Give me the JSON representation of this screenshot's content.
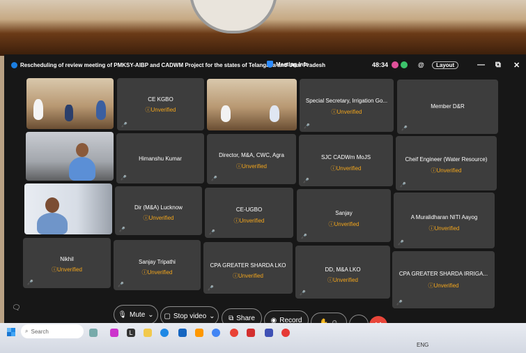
{
  "window": {
    "title": "Rescheduling of review meeting of PMKSY-AIBP and CADWM Project for the states of Telangana and Uttar Pradesh",
    "meeting_info": "Meeting Info",
    "timer": "48:34",
    "layout": "Layout",
    "minimize": "—",
    "restore": "⧉",
    "close": "✕"
  },
  "unverified_label": "Unverified",
  "tiles": [
    {
      "name": "",
      "video": true
    },
    {
      "name": "CE KGBO",
      "unverified": true
    },
    {
      "name": "",
      "video": true
    },
    {
      "name": "Special Secretary, Irrigation Go...",
      "unverified": true
    },
    {
      "name": "Member D&R"
    },
    {
      "name": "",
      "video": true
    },
    {
      "name": "Himanshu Kumar"
    },
    {
      "name": "Director, M&A, CWC, Agra",
      "unverified": true
    },
    {
      "name": "SJC CADWm MoJS",
      "unverified": true
    },
    {
      "name": "Cheif Engineer (Water Resource)",
      "unverified": true
    },
    {
      "name": "",
      "video": true
    },
    {
      "name": "Dir (M&A) Lucknow",
      "unverified": true
    },
    {
      "name": "CE-UGBO",
      "unverified": true
    },
    {
      "name": "Sanjay",
      "unverified": true
    },
    {
      "name": "A Muralidharan NITI Aayog",
      "unverified": true
    },
    {
      "name": "Nikhil",
      "unverified": true
    },
    {
      "name": "Sanjay Tripathi",
      "unverified": true
    },
    {
      "name": "CPA GREATER SHARDA LKO",
      "unverified": true
    },
    {
      "name": "DD, M&A LKO",
      "unverified": true
    },
    {
      "name": "CPA GREATER SHARDA IRRIGA...",
      "unverified": true
    }
  ],
  "toolbar": {
    "mute": "Mute",
    "stop_video": "Stop video",
    "share": "Share",
    "record": "Record",
    "more": "···",
    "leave": "✕"
  },
  "taskbar": {
    "search_placeholder": "Search",
    "lang": "ENG"
  }
}
